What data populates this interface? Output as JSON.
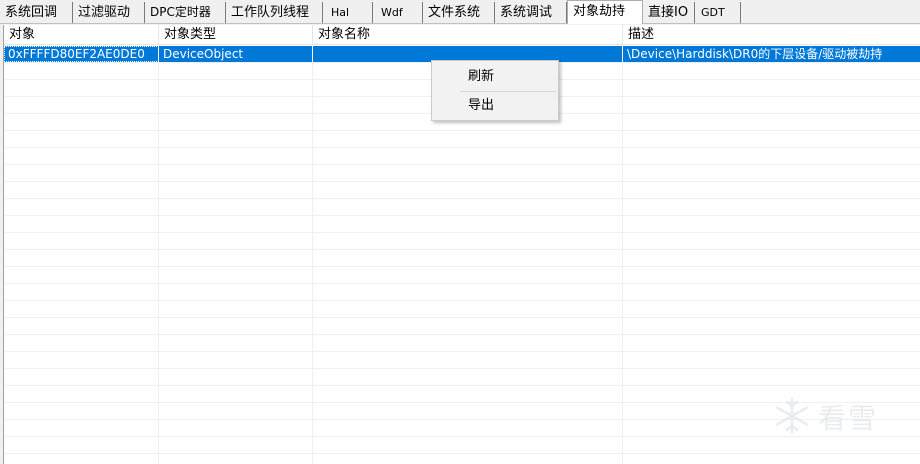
{
  "tabs": [
    {
      "label": "系统回调",
      "active": false
    },
    {
      "label": "过滤驱动",
      "active": false
    },
    {
      "label": "DPC定时器",
      "active": false
    },
    {
      "label": "工作队列线程",
      "active": false
    },
    {
      "label": "Hal",
      "active": false
    },
    {
      "label": "Wdf",
      "active": false
    },
    {
      "label": "文件系统",
      "active": false
    },
    {
      "label": "系统调试",
      "active": false
    },
    {
      "label": "对象劫持",
      "active": true
    },
    {
      "label": "直接IO",
      "active": false
    },
    {
      "label": "GDT",
      "active": false
    }
  ],
  "table": {
    "columns": [
      "对象",
      "对象类型",
      "对象名称",
      "描述"
    ],
    "rows": [
      {
        "object": "0xFFFFD80EF2AE0DE0",
        "type": "DeviceObject",
        "name": "",
        "description": "\\Device\\Harddisk\\DR0的下层设备/驱动被劫持",
        "selected": true
      }
    ]
  },
  "context_menu": {
    "items": [
      "刷新",
      "导出"
    ]
  },
  "watermark": {
    "text": "看雪",
    "icon": "snowflake-icon"
  },
  "colors": {
    "selection": "#0078d7",
    "tab_bg": "#f0f0f0"
  }
}
